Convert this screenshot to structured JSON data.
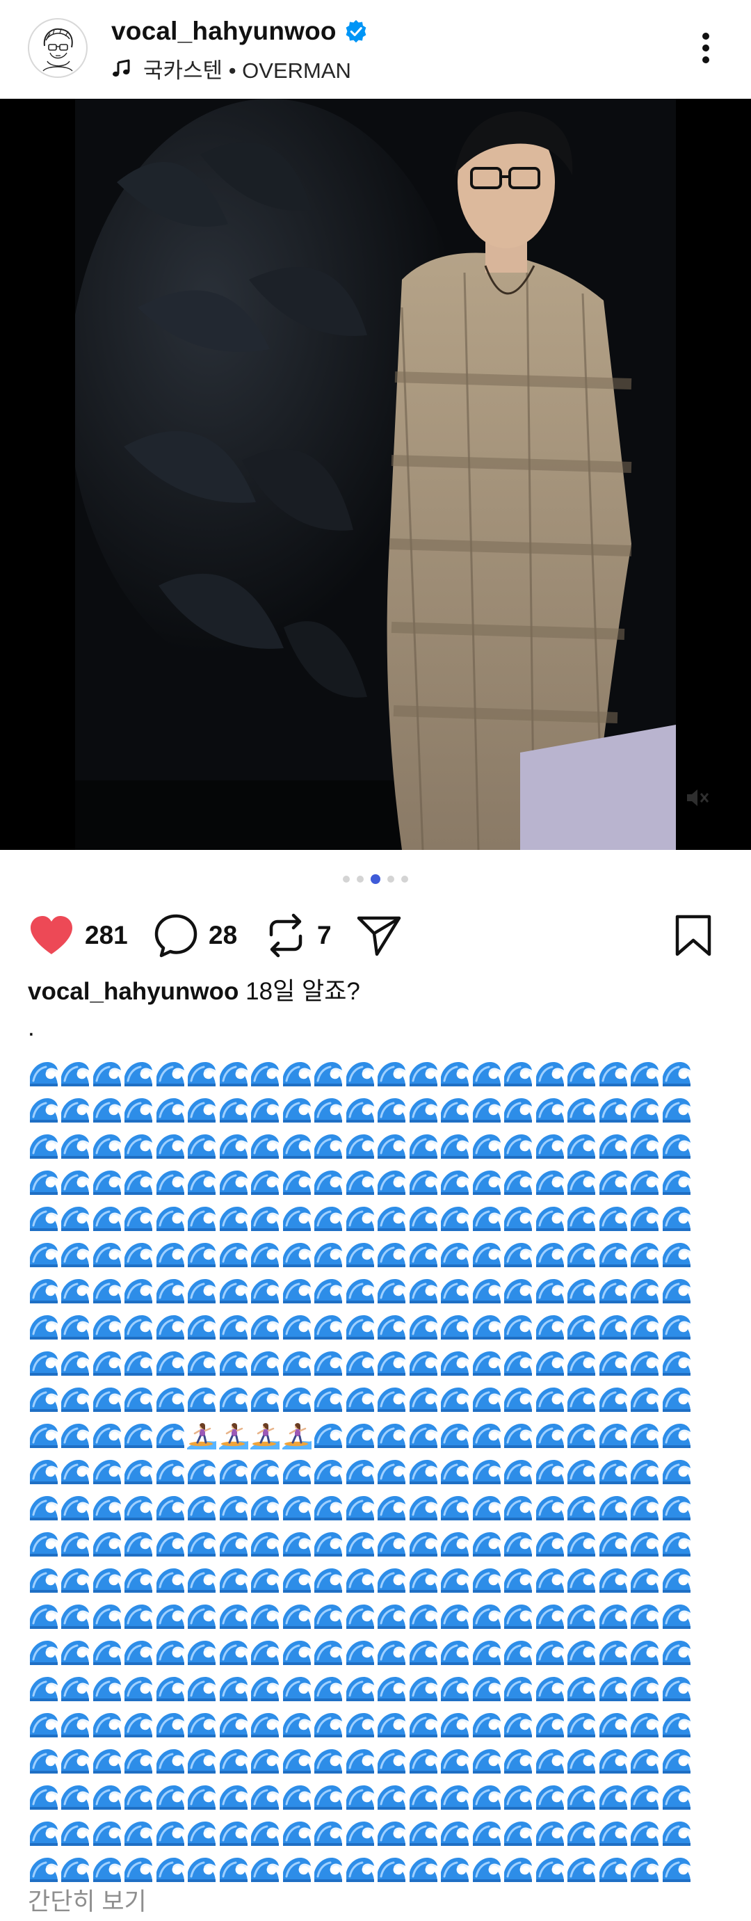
{
  "header": {
    "username": "vocal_hahyunwoo",
    "verified": true,
    "music_label": "국카스텐 • OVERMAN",
    "icons": {
      "avatar": "avatar-illustration",
      "verified": "verified-badge-icon",
      "music": "music-note-icon",
      "more": "more-vertical-icon"
    }
  },
  "media": {
    "description_icon": "photo",
    "volume_icon": "volume-muted-icon",
    "pagination": {
      "total": 5,
      "active_index": 2
    }
  },
  "actions": {
    "like_count": "281",
    "comment_count": "28",
    "repost_count": "7",
    "like_color": "#ed4956",
    "active_dot_color": "#3f5bd8"
  },
  "caption": {
    "username": "vocal_hahyunwoo",
    "text": "18일 알죠?",
    "separator": ".",
    "wave_emoji": "🌊",
    "surfer_emoji": "🏄‍♀️",
    "wave_rows": [
      "🌊🌊🌊🌊🌊🌊🌊🌊🌊🌊🌊🌊🌊🌊🌊🌊🌊🌊🌊🌊🌊",
      "🌊🌊🌊🌊🌊🌊🌊🌊🌊🌊🌊🌊🌊🌊🌊🌊🌊🌊🌊🌊🌊",
      "🌊🌊🌊🌊🌊🌊🌊🌊🌊🌊🌊🌊🌊🌊🌊🌊🌊🌊🌊🌊🌊",
      "🌊🌊🌊🌊🌊🌊🌊🌊🌊🌊🌊🌊🌊🌊🌊🌊🌊🌊🌊🌊🌊",
      "🌊🌊🌊🌊🌊🌊🌊🌊🌊🌊🌊🌊🌊🌊🌊🌊🌊🌊🌊🌊🌊",
      "🌊🌊🌊🌊🌊🌊🌊🌊🌊🌊🌊🌊🌊🌊🌊🌊🌊🌊🌊🌊🌊",
      "🌊🌊🌊🌊🌊🌊🌊🌊🌊🌊🌊🌊🌊🌊🌊🌊🌊🌊🌊🌊🌊",
      "🌊🌊🌊🌊🌊🌊🌊🌊🌊🌊🌊🌊🌊🌊🌊🌊🌊🌊🌊🌊🌊",
      "🌊🌊🌊🌊🌊🌊🌊🌊🌊🌊🌊🌊🌊🌊🌊🌊🌊🌊🌊🌊🌊",
      "🌊🌊🌊🌊🌊🌊🌊🌊🌊🌊🌊🌊🌊🌊🌊🌊🌊🌊🌊🌊🌊",
      "🌊🌊🌊🌊🌊🏄‍♀️🏄‍♀️🏄‍♀️🏄‍♀️🌊🌊🌊🌊🌊🌊🌊🌊🌊🌊🌊🌊",
      "🌊🌊🌊🌊🌊🌊🌊🌊🌊🌊🌊🌊🌊🌊🌊🌊🌊🌊🌊🌊🌊",
      "🌊🌊🌊🌊🌊🌊🌊🌊🌊🌊🌊🌊🌊🌊🌊🌊🌊🌊🌊🌊🌊",
      "🌊🌊🌊🌊🌊🌊🌊🌊🌊🌊🌊🌊🌊🌊🌊🌊🌊🌊🌊🌊🌊",
      "🌊🌊🌊🌊🌊🌊🌊🌊🌊🌊🌊🌊🌊🌊🌊🌊🌊🌊🌊🌊🌊",
      "🌊🌊🌊🌊🌊🌊🌊🌊🌊🌊🌊🌊🌊🌊🌊🌊🌊🌊🌊🌊🌊",
      "🌊🌊🌊🌊🌊🌊🌊🌊🌊🌊🌊🌊🌊🌊🌊🌊🌊🌊🌊🌊🌊",
      "🌊🌊🌊🌊🌊🌊🌊🌊🌊🌊🌊🌊🌊🌊🌊🌊🌊🌊🌊🌊🌊",
      "🌊🌊🌊🌊🌊🌊🌊🌊🌊🌊🌊🌊🌊🌊🌊🌊🌊🌊🌊🌊🌊",
      "🌊🌊🌊🌊🌊🌊🌊🌊🌊🌊🌊🌊🌊🌊🌊🌊🌊🌊🌊🌊🌊",
      "🌊🌊🌊🌊🌊🌊🌊🌊🌊🌊🌊🌊🌊🌊🌊🌊🌊🌊🌊🌊🌊",
      "🌊🌊🌊🌊🌊🌊🌊🌊🌊🌊🌊🌊🌊🌊🌊🌊🌊🌊🌊🌊🌊",
      "🌊🌊🌊🌊🌊🌊🌊🌊🌊🌊🌊🌊🌊🌊🌊🌊🌊🌊🌊🌊🌊"
    ],
    "collapse_label": "간단히 보기"
  }
}
